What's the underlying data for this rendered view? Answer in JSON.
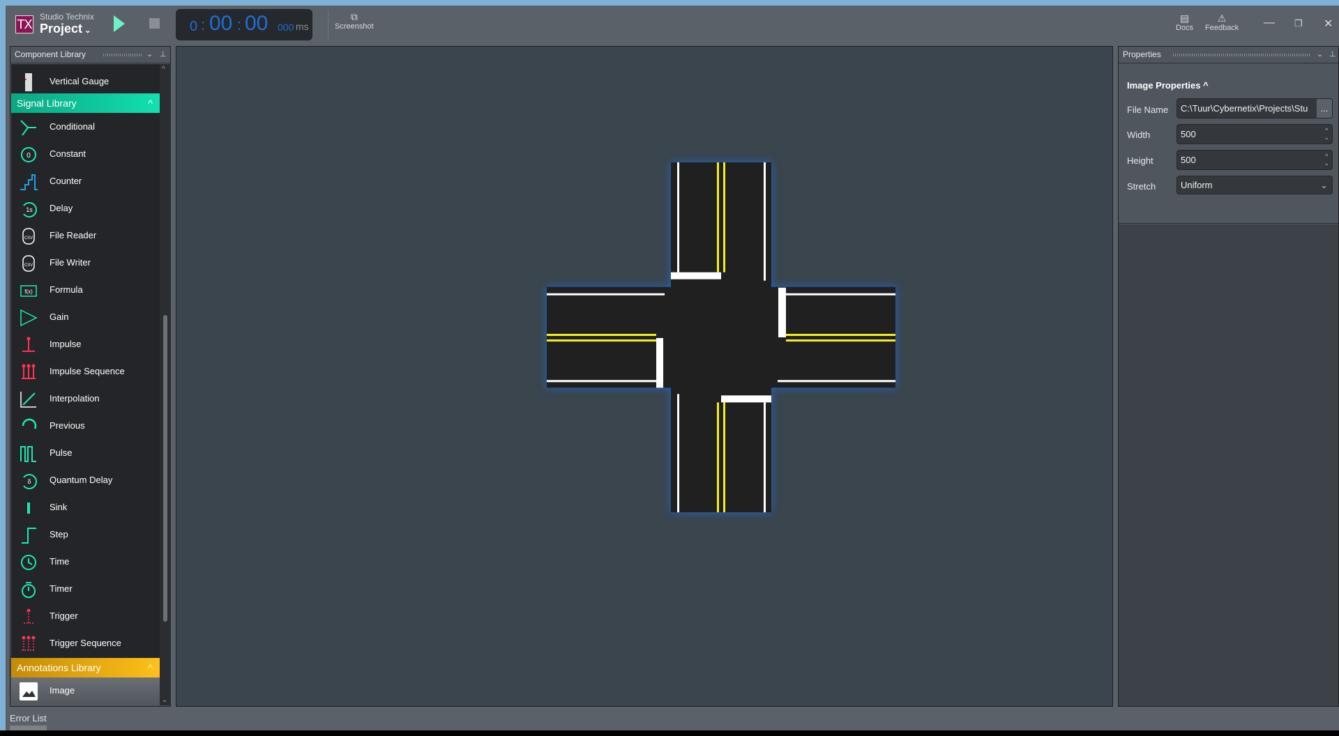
{
  "app": {
    "brand": "Studio Technix",
    "project": "Project",
    "logo_text": "TX"
  },
  "toolbar": {
    "timer": {
      "minutes": "0",
      "seconds_a": "00",
      "seconds_b": "00",
      "ms": "000",
      "unit": "ms"
    },
    "screenshot_label": "Screenshot",
    "docs_label": "Docs",
    "feedback_label": "Feedback"
  },
  "component_library": {
    "title": "Component Library",
    "top_item": "Vertical Gauge",
    "signal_section": "Signal Library",
    "signal_items": [
      "Conditional",
      "Constant",
      "Counter",
      "Delay",
      "File Reader",
      "File Writer",
      "Formula",
      "Gain",
      "Impulse",
      "Impulse Sequence",
      "Interpolation",
      "Previous",
      "Pulse",
      "Quantum Delay",
      "Sink",
      "Step",
      "Time",
      "Timer",
      "Trigger",
      "Trigger Sequence"
    ],
    "annotations_section": "Annotations Library",
    "annotation_items": [
      "Image"
    ],
    "colors": {
      "signal": "#0fd1a0",
      "annotations": "#f2b20f"
    }
  },
  "properties": {
    "title": "Properties",
    "section": "Image Properties",
    "file_name_label": "File Name",
    "file_name": "C:\\Tuur\\Cybernetix\\Projects\\Stu",
    "browse": "...",
    "width_label": "Width",
    "width": "500",
    "height_label": "Height",
    "height": "500",
    "stretch_label": "Stretch",
    "stretch": "Uniform"
  },
  "footer": {
    "error_list": "Error List"
  }
}
